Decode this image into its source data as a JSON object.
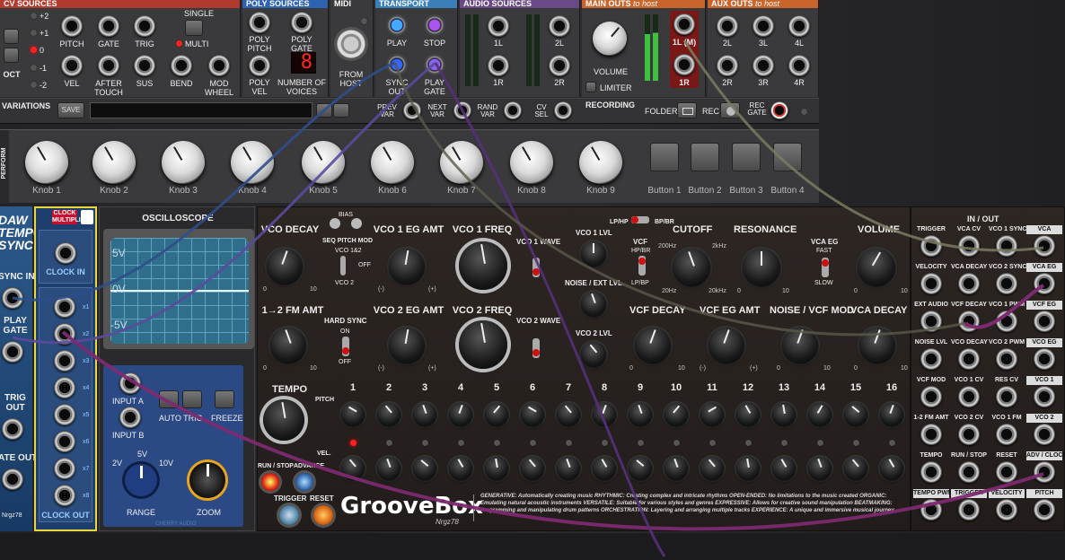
{
  "cv": {
    "title": "CV SOURCES",
    "oct": "OCT",
    "oct_values": [
      "+2",
      "+1",
      "0",
      "-1",
      "-2"
    ],
    "single": "SINGLE",
    "multi": "MULTI",
    "labels": [
      "PITCH",
      "GATE",
      "TRIG",
      "VEL",
      "AFTER TOUCH",
      "SUS",
      "BEND",
      "MOD WHEEL"
    ]
  },
  "poly": {
    "title": "POLY SOURCES",
    "labels": [
      "POLY PITCH",
      "POLY GATE",
      "POLY VEL",
      "NUMBER OF VOICES"
    ],
    "voices": "8"
  },
  "midi": {
    "title": "MIDI",
    "from": "FROM HOST"
  },
  "transport": {
    "title": "TRANSPORT",
    "labels": [
      "PLAY",
      "STOP",
      "SYNC OUT",
      "PLAY GATE"
    ]
  },
  "audio": {
    "title": "AUDIO SOURCES",
    "labels": [
      "1L",
      "2L",
      "1R",
      "2R"
    ]
  },
  "main": {
    "title": "MAIN OUTS",
    "suffix": "to host",
    "volume": "VOLUME",
    "limiter": "LIMITER",
    "labels": [
      "1L (M)",
      "1R"
    ]
  },
  "aux": {
    "title": "AUX OUTS",
    "suffix": "to host",
    "labels": [
      "2L",
      "3L",
      "4L",
      "2R",
      "3R",
      "4R"
    ]
  },
  "variations": {
    "title": "VARIATIONS",
    "save": "SAVE",
    "prev": "PREV VAR",
    "next": "NEXT VAR",
    "rand": "RAND VAR",
    "cv": "CV SEL"
  },
  "recording": {
    "title": "RECORDING",
    "folder": "FOLDER",
    "rec": "REC",
    "recgate": "REC GATE"
  },
  "perform": {
    "title": "PERFORM",
    "knobs": [
      "Knob 1",
      "Knob 2",
      "Knob 3",
      "Knob 4",
      "Knob 5",
      "Knob 6",
      "Knob 7",
      "Knob 8",
      "Knob 9"
    ],
    "buttons": [
      "Button 1",
      "Button 2",
      "Button 3",
      "Button 4"
    ]
  },
  "left": {
    "daw": "DAW TEMPO SYNC",
    "sync_in": "SYNC IN",
    "play_gate": "PLAY GATE",
    "trig_out": "TRIG OUT",
    "gate_out": "ATE OUT",
    "brand": "Nrgz78"
  },
  "clock": {
    "title": "CLOCK MULTIPLIER",
    "clock_in": "CLOCK IN",
    "clock_out": "CLOCK OUT",
    "mults": [
      "x1",
      "x2",
      "x3",
      "x4",
      "x5",
      "x6",
      "x7",
      "x8"
    ]
  },
  "scope": {
    "title": "OSCILLOSCOPE",
    "labels": [
      "5V",
      "0V",
      "-5V"
    ],
    "input_a": "INPUT A",
    "input_b": "INPUT B",
    "auto": "AUTO TRIG",
    "freeze": "FREEZE",
    "range": "RANGE",
    "zoom": "ZOOM",
    "r2": "2V",
    "r5": "5V",
    "r10": "10V",
    "brand": "CHERRY AUDIO"
  },
  "groove": {
    "bias": "BIAS",
    "seqmod": "SEQ PITCH MOD",
    "vco12": "VCO 1&2",
    "off": "OFF",
    "vco2": "VCO 2",
    "knobs": [
      "VCO DECAY",
      "VCO 1 EG AMT",
      "VCO 1 FREQ",
      "1→2 FM AMT",
      "VCO 2 EG AMT",
      "VCO 2 FREQ"
    ],
    "vco1wave": "VCO 1 WAVE",
    "vco2wave": "VCO 2 WAVE",
    "hardsync": "HARD SYNC",
    "on": "ON",
    "vco1lvl": "VCO 1 LVL",
    "noise": "NOISE / EXT LVL",
    "vco2lvl": "VCO 2 LVL",
    "lphp": "LP/HP",
    "bpbr": "BP/BR",
    "vcf": "VCF",
    "hpbr": "HP/BR",
    "lpbp": "LP/BP",
    "cutoff": "CUTOFF",
    "resonance": "RESONANCE",
    "vcaeg": "VCA EG",
    "fast": "FAST",
    "slow": "SLOW",
    "volume": "VOLUME",
    "f200": "200Hz",
    "f2k": "2kHz",
    "f20": "20Hz",
    "f20k": "20kHz",
    "knobs2": [
      "VCF DECAY",
      "VCF EG AMT",
      "NOISE / VCF MOD",
      "VCA DECAY"
    ],
    "tempo": "TEMPO",
    "pitch": "PITCH",
    "vel": "VEL.",
    "steps": [
      "1",
      "2",
      "3",
      "4",
      "5",
      "6",
      "7",
      "8",
      "9",
      "10",
      "11",
      "12",
      "13",
      "14",
      "15",
      "16"
    ],
    "runstop": "RUN / STOP",
    "advance": "ADVANCE",
    "trigger": "TRIGGER",
    "reset": "RESET",
    "logo": "GrooveBox",
    "sub": "Nrgz78",
    "desc": "GENERATIVE: Automatically creating music  RHYTHMIC: Creating complex and intricate rhythms  OPEN-ENDED: No limitations to the music created  ORGANIC: Emulating natural acoustic instruments  VERSATILE: Suitable for various styles and genres  EXPRESSIVE: Allows for creative sound manipulation  BEATMAKING: Programming and manipulating drum patterns  ORCHESTRATION: Layering and arranging multiple tracks  EXPERIENCE: A unique and immersive musical journey.",
    "io_title": "IN / OUT",
    "io": [
      "TRIGGER",
      "VCA CV",
      "VCO 1 SYNC",
      "VCA",
      "VELOCITY",
      "VCA DECAY",
      "VCO 2 SYNC",
      "VCA EG",
      "EXT AUDIO",
      "VCF DECAY",
      "VCO 1 PWM",
      "VCF EG",
      "NOISE LVL",
      "VCO DECAY",
      "VCO 2 PWM",
      "VCO EG",
      "VCF MOD",
      "VCO 1 CV",
      "RES CV",
      "VCO 1",
      "1-2 FM AMT",
      "VCO 2 CV",
      "VCO 1 FM",
      "VCO 2",
      "TEMPO",
      "RUN / STOP",
      "RESET",
      "ADV / CLOCK",
      "TEMPO PWM",
      "TRIGGER",
      "VELOCITY",
      "PITCH"
    ]
  },
  "tick": {
    "zero": "0",
    "ten": "10",
    "neg": "(-)",
    "pos": "(+)"
  }
}
